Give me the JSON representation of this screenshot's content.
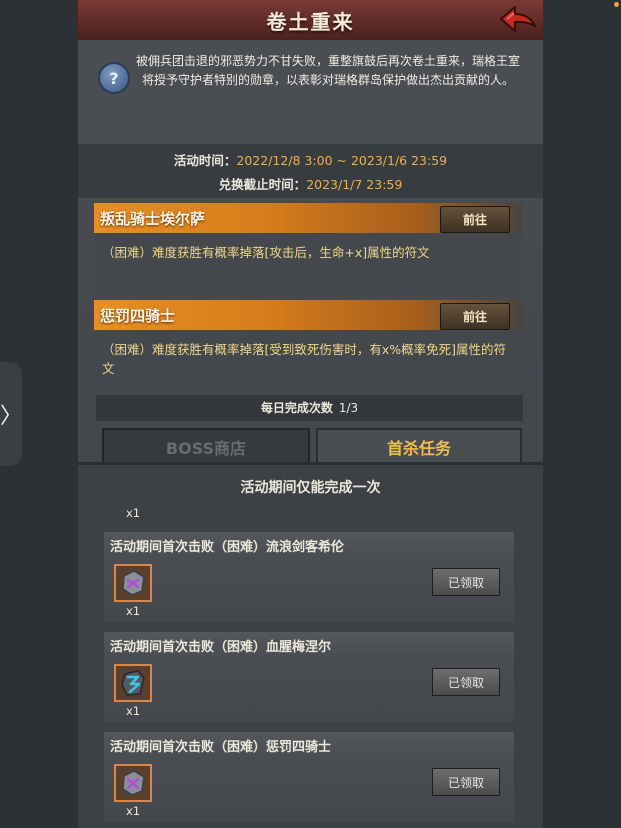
{
  "header": {
    "title": "卷土重来"
  },
  "intro": {
    "text": "被佣兵团击退的邪恶势力不甘失败，重整旗鼓后再次卷土重来，瑞格王室将授予守护者特别的勋章，以表彰对瑞格群岛保护做出杰出贡献的人。"
  },
  "times": {
    "activity_label": "活动时间：",
    "activity_value": "2022/12/8 3:00 ~ 2023/1/6 23:59",
    "exchange_label": "兑换截止时间：",
    "exchange_value": "2023/1/7 23:59"
  },
  "bosses": [
    {
      "name": "叛乱骑士埃尔萨",
      "go_label": "前往",
      "desc": "（困难）难度获胜有概率掉落[攻击后，生命+x]属性的符文"
    },
    {
      "name": "惩罚四骑士",
      "go_label": "前往",
      "desc": "（困难）难度获胜有概率掉落[受到致死伤害时，有x%概率免死]属性的符文"
    }
  ],
  "daily": {
    "label": "每日完成次数",
    "value": "1/3"
  },
  "tabs": [
    {
      "label": "BOSS商店",
      "active": false
    },
    {
      "label": "首杀任务",
      "active": true
    }
  ],
  "section": {
    "title": "活动期间仅能完成一次",
    "top_qty": "x1"
  },
  "tasks": [
    {
      "title": "活动期间首次击败（困难）流浪剑客希伦",
      "qty": "x1",
      "status": "已领取",
      "icon": "purple-rune-icon",
      "rune_color": "#b04adf"
    },
    {
      "title": "活动期间首次击败（困难）血腥梅涅尔",
      "qty": "x1",
      "status": "已领取",
      "icon": "cyan-rune-icon",
      "rune_color": "#3fc6e0"
    },
    {
      "title": "活动期间首次击败（困难）惩罚四骑士",
      "qty": "x1",
      "status": "已领取",
      "icon": "purple-rune-icon",
      "rune_color": "#b04adf"
    }
  ],
  "colors": {
    "accent": "#e9b24a",
    "boss_bar": "#e58f24",
    "header": "#6a312d"
  }
}
